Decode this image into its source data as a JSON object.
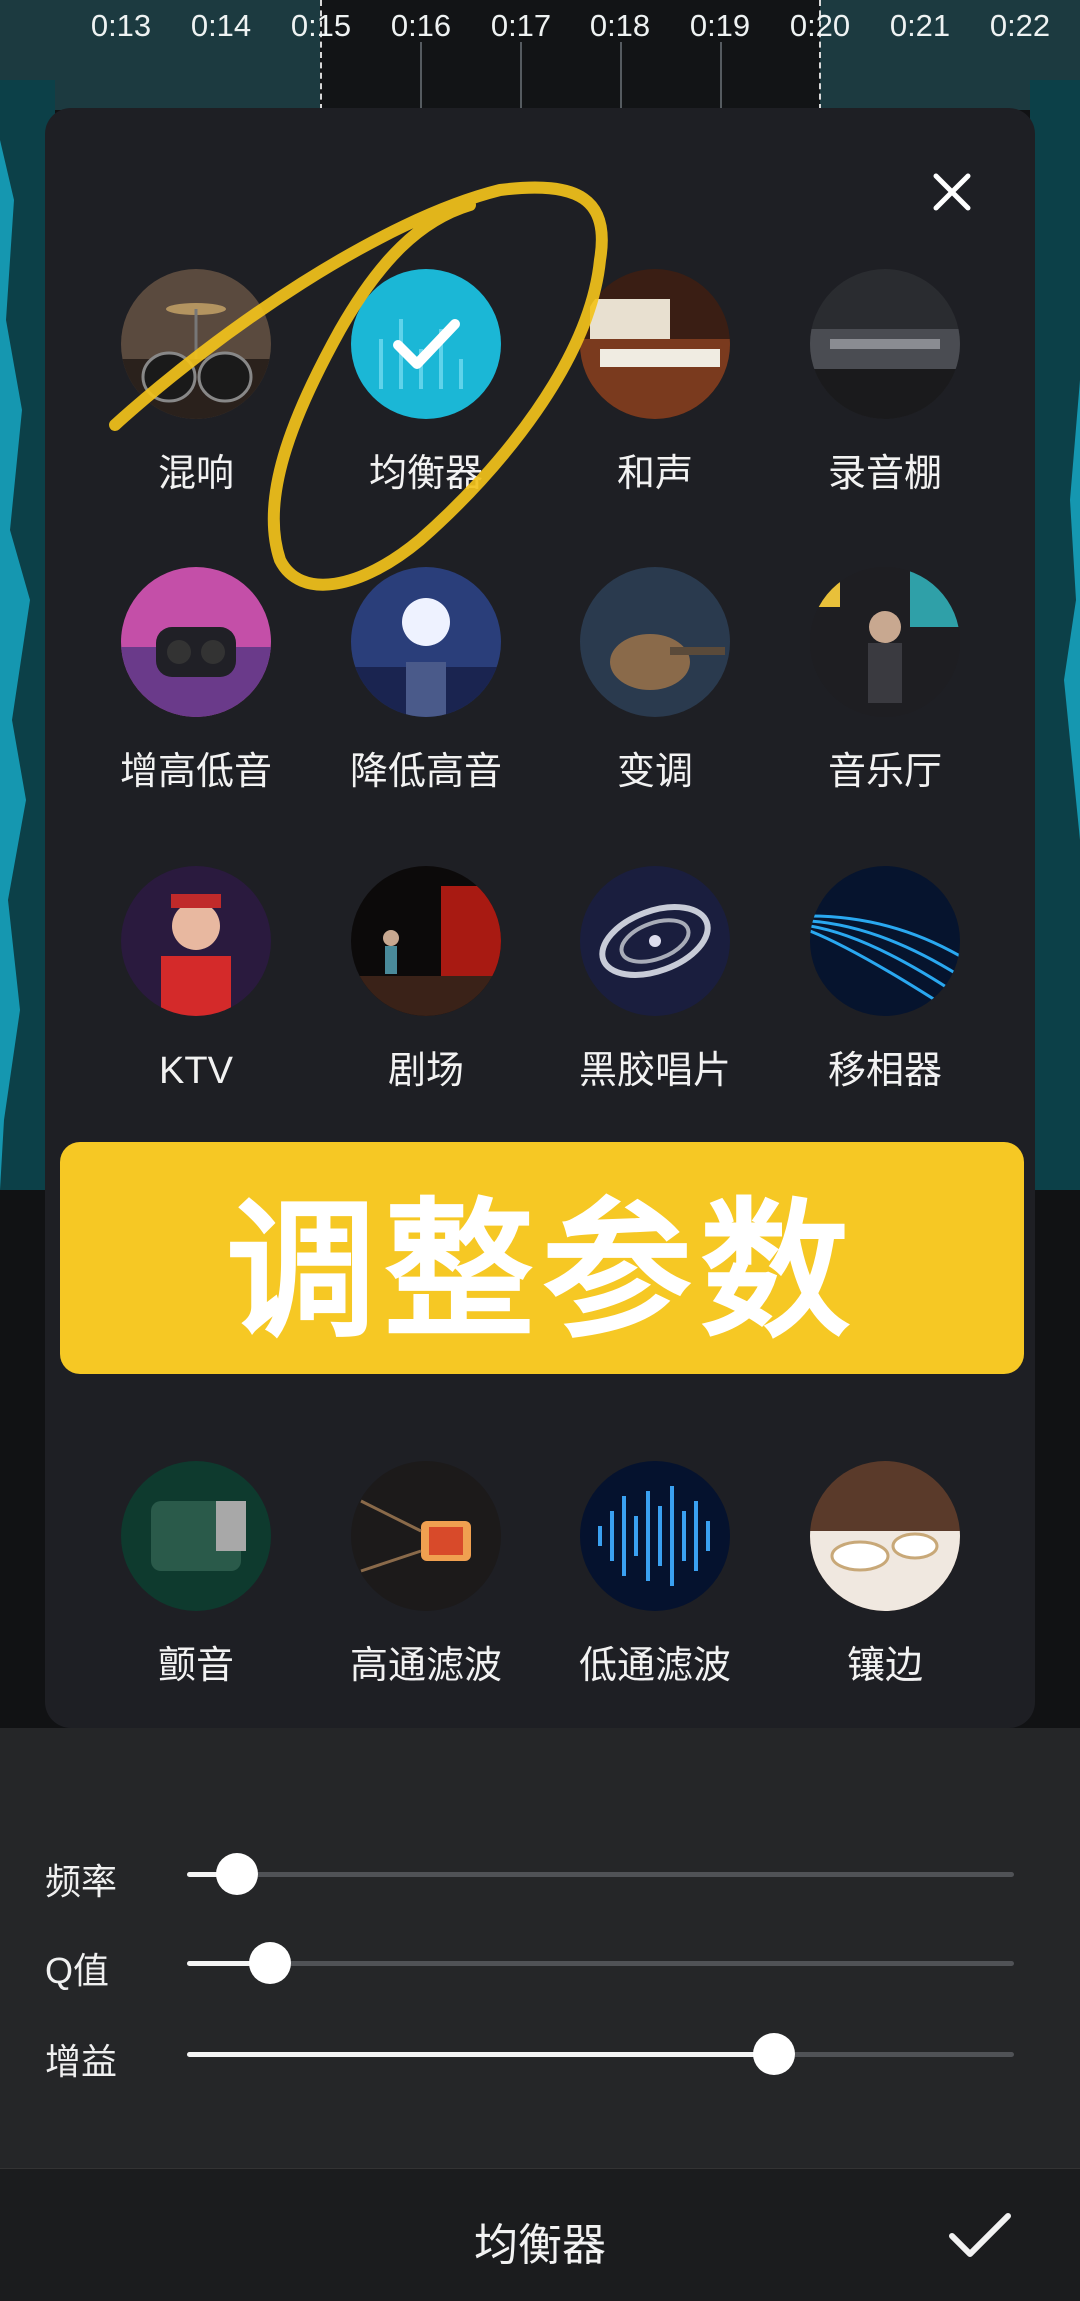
{
  "timeline": {
    "ticks": [
      "0:13",
      "0:14",
      "0:15",
      "0:16",
      "0:17",
      "0:18",
      "0:19",
      "0:20",
      "0:21",
      "0:22"
    ]
  },
  "effects_panel": {
    "close_icon": "close-icon",
    "selected_icon": "check-icon",
    "selected_color": "#1bb7d6",
    "effects": [
      {
        "label": "混响",
        "selected": false
      },
      {
        "label": "均衡器",
        "selected": true
      },
      {
        "label": "和声",
        "selected": false
      },
      {
        "label": "录音棚",
        "selected": false
      },
      {
        "label": "增高低音",
        "selected": false
      },
      {
        "label": "降低高音",
        "selected": false
      },
      {
        "label": "变调",
        "selected": false
      },
      {
        "label": "音乐厅",
        "selected": false
      },
      {
        "label": "KTV",
        "selected": false
      },
      {
        "label": "剧场",
        "selected": false
      },
      {
        "label": "黑胶唱片",
        "selected": false
      },
      {
        "label": "移相器",
        "selected": false
      },
      {
        "label": "颤音",
        "selected": false
      },
      {
        "label": "高通滤波",
        "selected": false
      },
      {
        "label": "低通滤波",
        "selected": false
      },
      {
        "label": "镶边",
        "selected": false
      }
    ]
  },
  "banner": {
    "text": "调整参数",
    "color": "#f6c824"
  },
  "sliders": [
    {
      "label": "频率",
      "value": 0.06
    },
    {
      "label": "Q值",
      "value": 0.1
    },
    {
      "label": "增益",
      "value": 0.71
    }
  ],
  "bottom_bar": {
    "title": "均衡器",
    "confirm_icon": "check-icon"
  },
  "annotation_color": "#f2c21b"
}
